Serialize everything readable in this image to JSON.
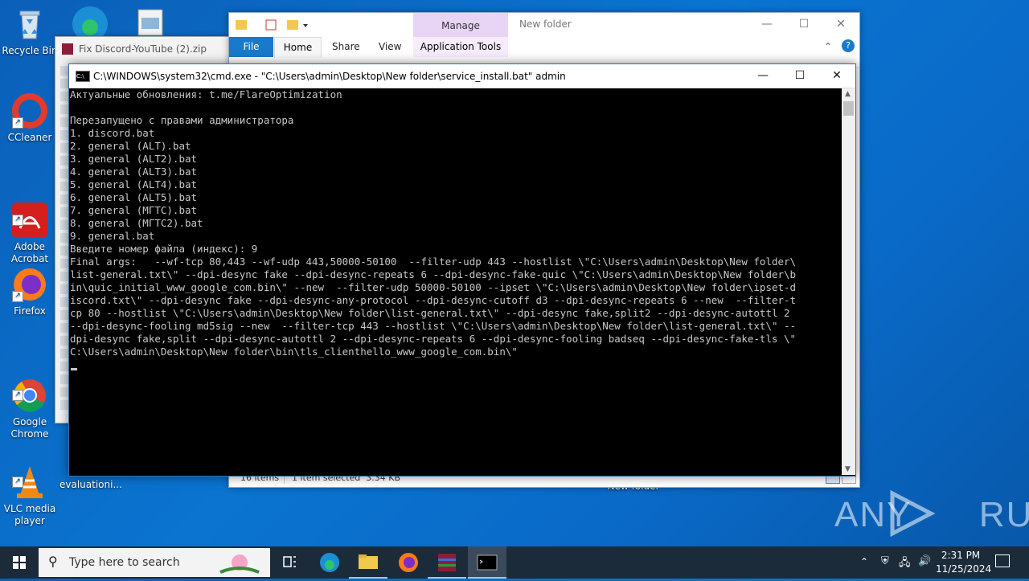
{
  "desktop": {
    "icons": [
      {
        "label": "Recycle Bin"
      },
      {
        "label": "CCleaner"
      },
      {
        "label": "Adobe\nAcrobat"
      },
      {
        "label": "Firefox"
      },
      {
        "label": "Google\nChrome"
      },
      {
        "label": "VLC media\nplayer"
      },
      {
        "label": "evaluationi..."
      },
      {
        "label": "New folder"
      }
    ]
  },
  "zip_window": {
    "title": "Fix Discord-YouTube (2).zip"
  },
  "explorer": {
    "title": "New folder",
    "context_tab_group": "Manage",
    "tabs": [
      "File",
      "Home",
      "Share",
      "View",
      "Application Tools"
    ],
    "status": {
      "items": "16 items",
      "selected": "1 item selected  3.34 KB"
    }
  },
  "cmd": {
    "title": "C:\\WINDOWS\\system32\\cmd.exe - \"C:\\Users\\admin\\Desktop\\New folder\\service_install.bat\"  admin",
    "lines": [
      "Актуальные обновления: t.me/FlareOptimization",
      "",
      "Перезапущено с правами администратора",
      "1. discord.bat",
      "2. general (ALT).bat",
      "3. general (ALT2).bat",
      "4. general (ALT3).bat",
      "5. general (ALT4).bat",
      "6. general (ALT5).bat",
      "7. general (МГТС).bat",
      "8. general (МГТС2).bat",
      "9. general.bat",
      "Введите номер файла (индекс): 9",
      "Final args:   --wf-tcp 80,443 --wf-udp 443,50000-50100  --filter-udp 443 --hostlist \\\"C:\\Users\\admin\\Desktop\\New folder\\",
      "list-general.txt\\\" --dpi-desync fake --dpi-desync-repeats 6 --dpi-desync-fake-quic \\\"C:\\Users\\admin\\Desktop\\New folder\\b",
      "in\\quic_initial_www_google_com.bin\\\" --new  --filter-udp 50000-50100 --ipset \\\"C:\\Users\\admin\\Desktop\\New folder\\ipset-d",
      "iscord.txt\\\" --dpi-desync fake --dpi-desync-any-protocol --dpi-desync-cutoff d3 --dpi-desync-repeats 6 --new  --filter-t",
      "cp 80 --hostlist \\\"C:\\Users\\admin\\Desktop\\New folder\\list-general.txt\\\" --dpi-desync fake,split2 --dpi-desync-autottl 2",
      "--dpi-desync-fooling md5sig --new  --filter-tcp 443 --hostlist \\\"C:\\Users\\admin\\Desktop\\New folder\\list-general.txt\\\" --",
      "dpi-desync fake,split --dpi-desync-autottl 2 --dpi-desync-repeats 6 --dpi-desync-fooling badseq --dpi-desync-fake-tls \\\"",
      "C:\\Users\\admin\\Desktop\\New folder\\bin\\tls_clienthello_www_google_com.bin\\\""
    ]
  },
  "taskbar": {
    "search_placeholder": "Type here to search",
    "time": "2:31 PM",
    "date": "11/25/2024"
  },
  "watermark": "ANY RUN",
  "colors": {
    "accent": "#0a74d0",
    "console_text": "#c8c8c8",
    "console_bg": "#000000"
  }
}
